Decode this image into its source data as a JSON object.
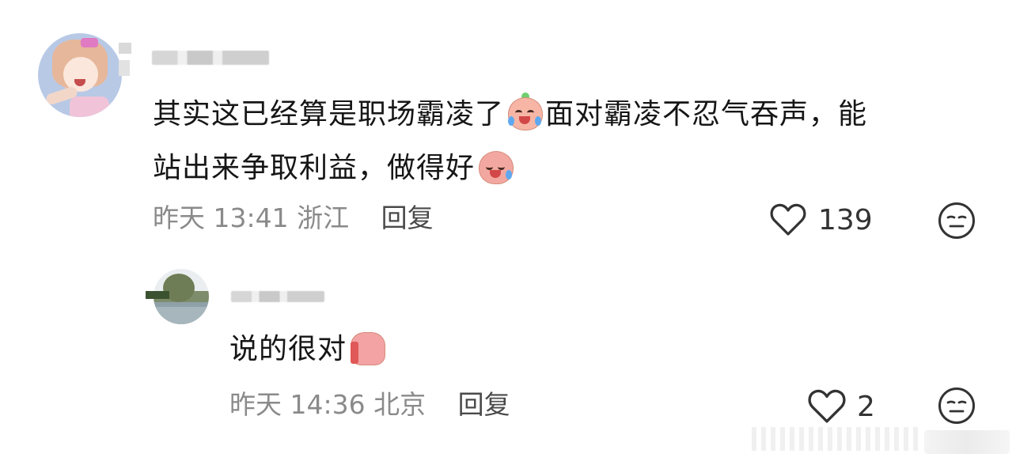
{
  "comments": [
    {
      "text_before": "其实这已经算是职场霸凌了",
      "text_after": "面对霸凌不忍气吞声，能",
      "text_line2": "站出来争取利益，做得好",
      "emoji_1": "crying-emoji-icon",
      "emoji_2": "angry-emoji-icon",
      "time": "昨天 13:41",
      "location": "浙江",
      "reply_label": "回复",
      "likes": "139"
    },
    {
      "text": "说的很对",
      "emoji": "thumbs-up-emoji-icon",
      "time": "昨天 14:36",
      "location": "北京",
      "reply_label": "回复",
      "likes": "2"
    }
  ],
  "colors": {
    "text": "#161616",
    "meta": "#8a8a8a",
    "icon": "#333333"
  }
}
